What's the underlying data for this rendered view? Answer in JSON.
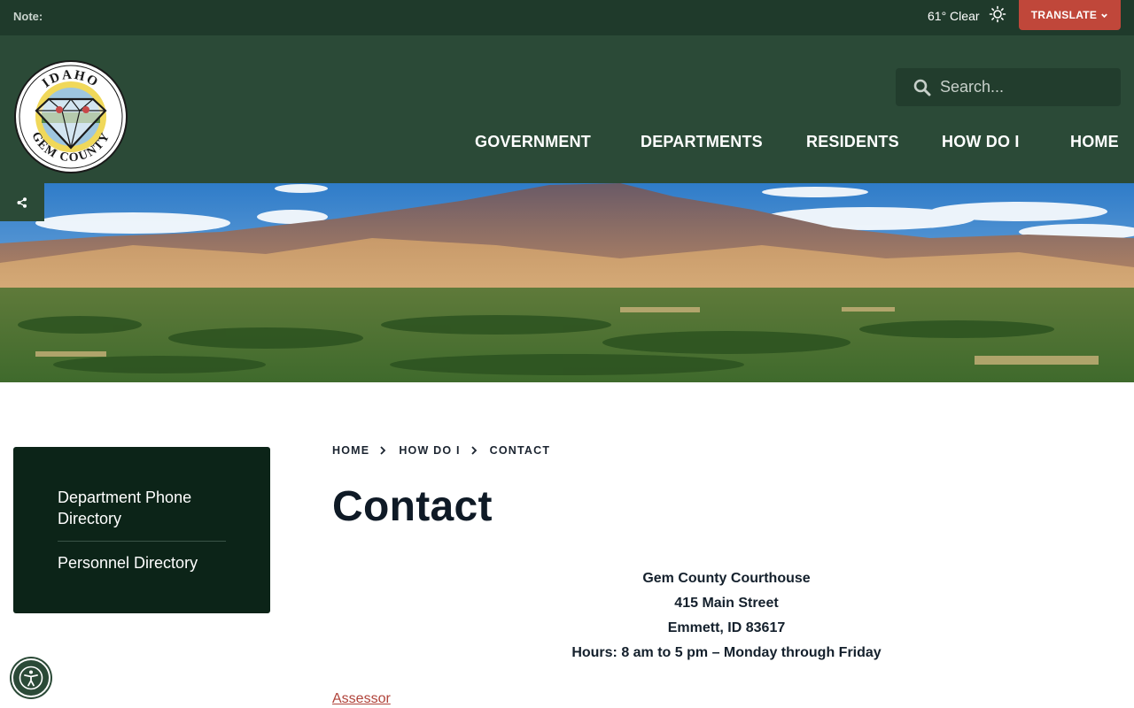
{
  "topbar": {
    "note_label": "Note:",
    "weather": "61° Clear",
    "weather_icon": "sun-icon",
    "translate_label": "TRANSLATE"
  },
  "header": {
    "logo_text_top": "IDAHO",
    "logo_text_bottom": "GEM COUNTY",
    "search_placeholder": "Search...",
    "nav": [
      "GOVERNMENT",
      "DEPARTMENTS",
      "RESIDENTS",
      "HOW DO I",
      "HOME"
    ]
  },
  "sidebar": {
    "items": [
      "Department Phone Directory",
      "Personnel Directory"
    ]
  },
  "breadcrumb": [
    "HOME",
    "HOW DO I",
    "CONTACT"
  ],
  "page": {
    "title": "Contact",
    "address_lines": [
      "Gem County Courthouse",
      "415 Main Street",
      "Emmett, ID 83617",
      "Hours: 8 am to 5 pm – Monday through Friday"
    ],
    "links": [
      "Assessor"
    ]
  },
  "colors": {
    "topbar": "#1f3a2b",
    "header": "#2b4a37",
    "sidebar": "#0c2418",
    "accent": "#c0473a",
    "link": "#b0433a"
  }
}
